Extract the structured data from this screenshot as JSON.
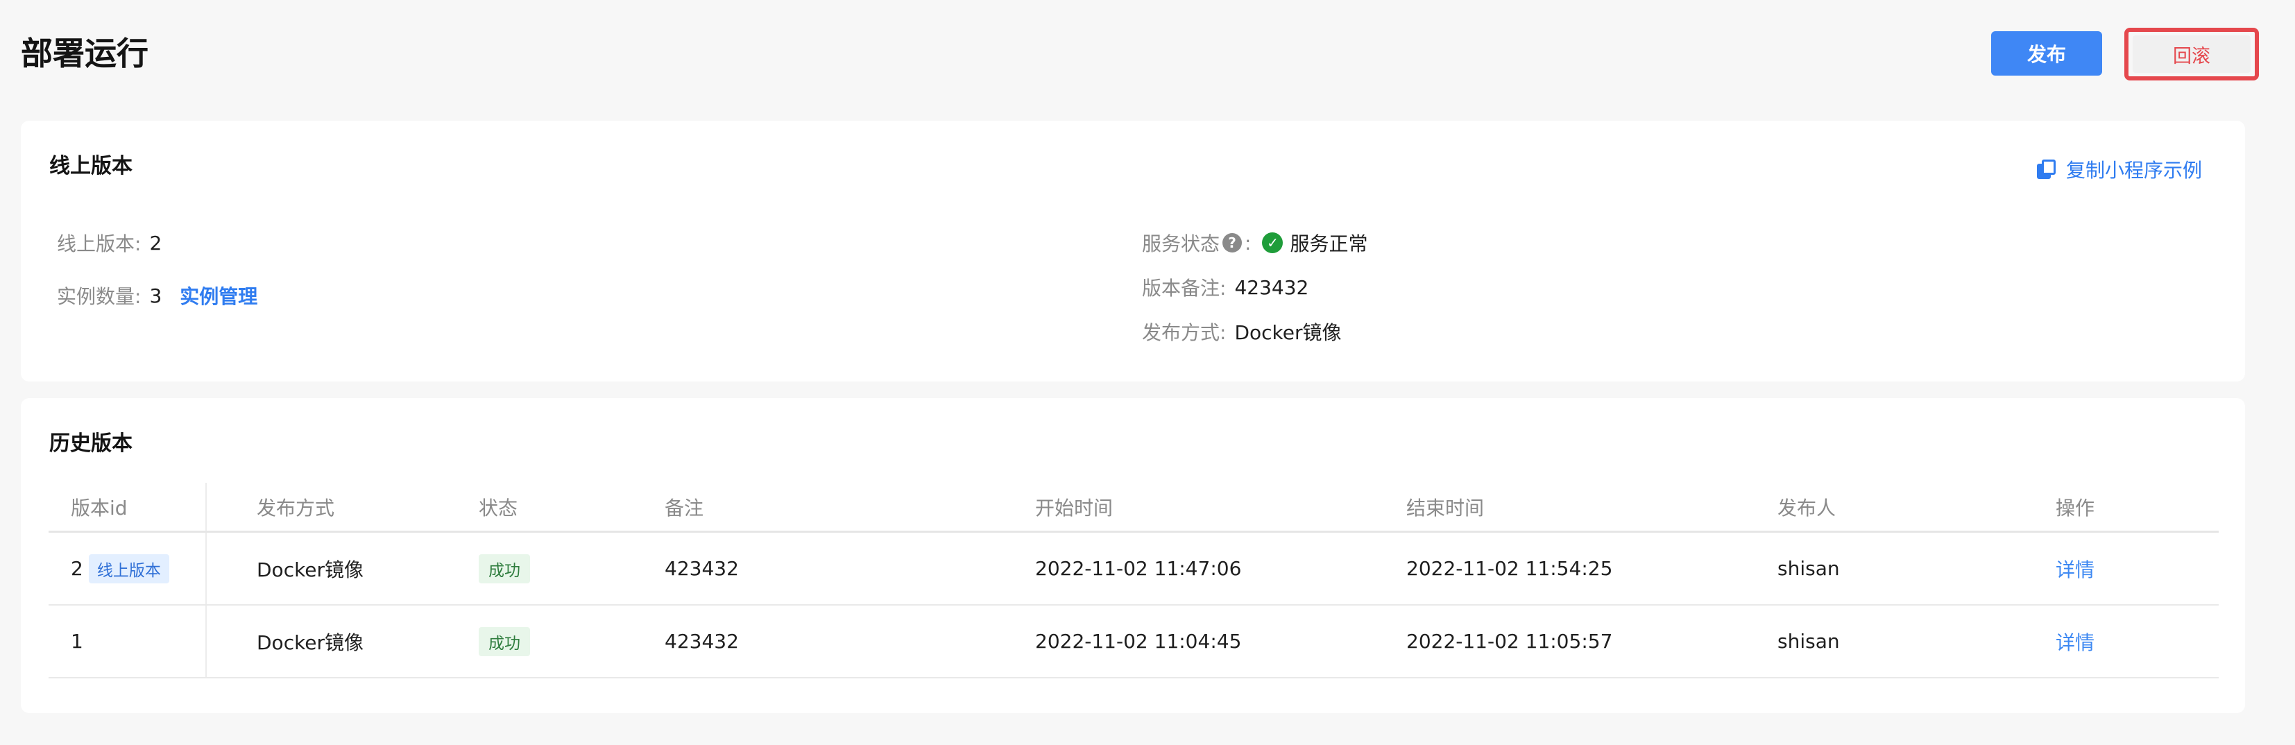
{
  "header": {
    "title": "部署运行",
    "publish_label": "发布",
    "rollback_label": "回滚"
  },
  "online": {
    "title": "线上版本",
    "copy_link": "复制小程序示例",
    "version_label": "线上版本:",
    "version_value": "2",
    "instances_label": "实例数量:",
    "instances_value": "3",
    "instance_manage": "实例管理",
    "service_status_label": "服务状态",
    "service_status_value": "服务正常",
    "remark_label": "版本备注:",
    "remark_value": "423432",
    "publish_method_label": "发布方式:",
    "publish_method_value": "Docker镜像"
  },
  "history": {
    "title": "历史版本",
    "columns": [
      "版本id",
      "发布方式",
      "状态",
      "备注",
      "开始时间",
      "结束时间",
      "发布人",
      "操作"
    ],
    "rows": [
      {
        "id": "2",
        "tag": "线上版本",
        "method": "Docker镜像",
        "status": "成功",
        "remark": "423432",
        "start": "2022-11-02 11:47:06",
        "end": "2022-11-02 11:54:25",
        "publisher": "shisan",
        "action": "详情"
      },
      {
        "id": "1",
        "tag": "",
        "method": "Docker镜像",
        "status": "成功",
        "remark": "423432",
        "start": "2022-11-02 11:04:45",
        "end": "2022-11-02 11:05:57",
        "publisher": "shisan",
        "action": "详情"
      }
    ]
  },
  "colors": {
    "primary": "#3f87f5",
    "danger": "#e5484d",
    "success": "#1f9d3a",
    "link": "#2f7cf0"
  },
  "icons": {
    "copy": "copy-icon",
    "help": "question-circle-icon",
    "ok": "check-circle-icon"
  }
}
